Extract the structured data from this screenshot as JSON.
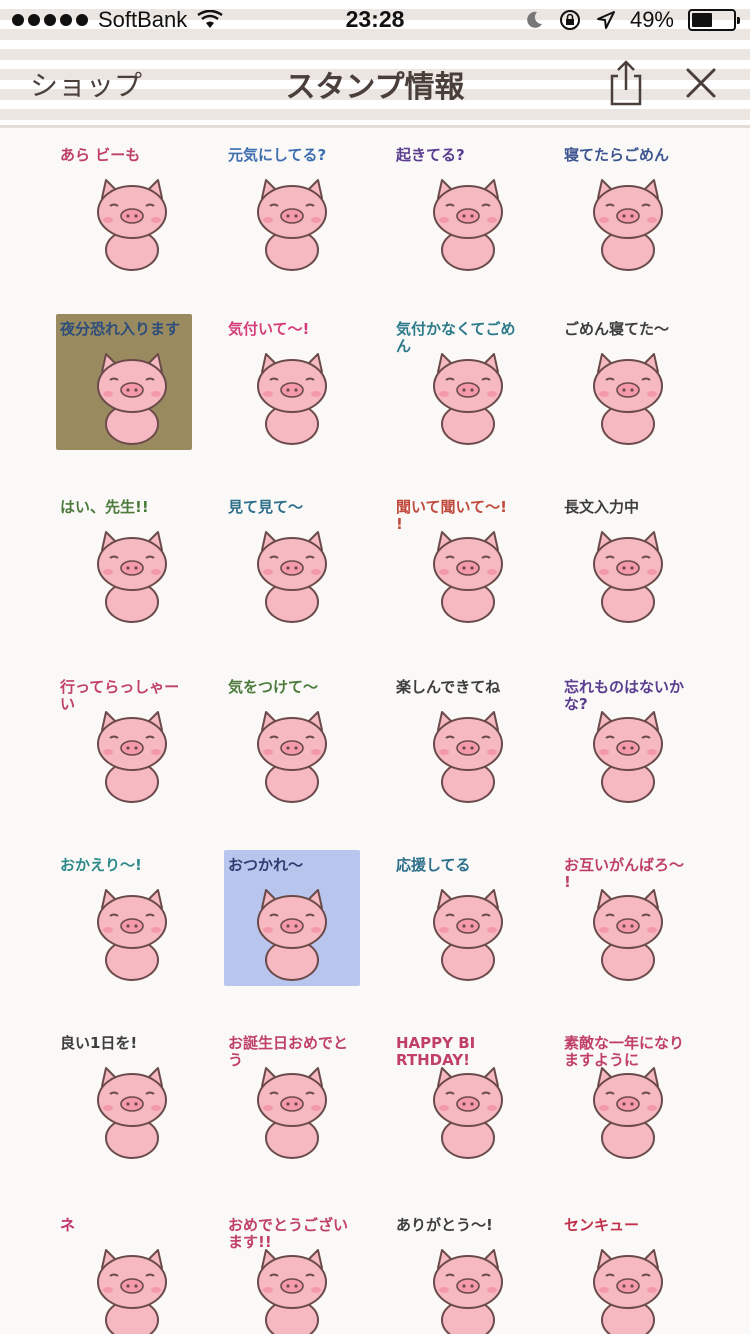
{
  "status_bar": {
    "carrier": "SoftBank",
    "time": "23:28",
    "battery_percent": "49%",
    "battery_level": 0.49,
    "icons": [
      "signal-dots-icon",
      "wifi-icon",
      "moon-icon",
      "rotation-lock-icon",
      "location-arrow-icon",
      "battery-icon"
    ]
  },
  "nav": {
    "back_label": "ショップ",
    "title": "スタンプ情報",
    "share_icon": "share-icon",
    "close_icon": "close-icon"
  },
  "colors": {
    "text": "#4a3f3a",
    "pig": "#f6b9c2",
    "pig_outline": "#6b4a4a",
    "background": "#faf9f7",
    "stripe": "#ebe6e1"
  },
  "stickers": [
    {
      "text": "あら ビーも",
      "color": "#c0406a",
      "bg": "none"
    },
    {
      "text": "元気にしてる?",
      "color": "#3d6fb0",
      "bg": "none"
    },
    {
      "text": "起きてる?",
      "color": "#5b3d8f",
      "bg": "none"
    },
    {
      "text": "寝てたらごめん",
      "color": "#3e5690",
      "bg": "none"
    },
    {
      "text": "夜分恐れ入ります",
      "color": "#2d4d7a",
      "bg": "#9a8a60"
    },
    {
      "text": "気付いて〜!",
      "color": "#d43d7a",
      "bg": "none"
    },
    {
      "text": "気付かなくてごめん",
      "color": "#2d7a8a",
      "bg": "none"
    },
    {
      "text": "ごめん寝てた〜",
      "color": "#3d3d3d",
      "bg": "none"
    },
    {
      "text": "はい、先生!!",
      "color": "#4d7a3d",
      "bg": "none"
    },
    {
      "text": "見て見て〜",
      "color": "#2d6f8a",
      "bg": "none"
    },
    {
      "text": "聞いて聞いて〜!!",
      "color": "#c04a3d",
      "bg": "none"
    },
    {
      "text": "長文入力中",
      "color": "#3d3d3d",
      "bg": "none"
    },
    {
      "text": "行ってらっしゃーい",
      "color": "#c0406a",
      "bg": "none"
    },
    {
      "text": "気をつけて〜",
      "color": "#4d7a3d",
      "bg": "none"
    },
    {
      "text": "楽しんできてね",
      "color": "#3d3d3d",
      "bg": "none"
    },
    {
      "text": "忘れものはないかな?",
      "color": "#5b3d8f",
      "bg": "none"
    },
    {
      "text": "おかえり〜!",
      "color": "#2d8a8a",
      "bg": "none"
    },
    {
      "text": "おつかれ〜",
      "color": "#2d3d6f",
      "bg": "#b8c6ee"
    },
    {
      "text": "応援してる",
      "color": "#2d6f8a",
      "bg": "none"
    },
    {
      "text": "お互いがんばろ〜!",
      "color": "#c0406a",
      "bg": "none"
    },
    {
      "text": "良い1日を!",
      "color": "#3d3d3d",
      "bg": "none"
    },
    {
      "text": "お誕生日おめでとう",
      "color": "#c0406a",
      "bg": "none"
    },
    {
      "text": "HAPPY BIRTHDAY!",
      "color": "#c0406a",
      "bg": "none"
    },
    {
      "text": "素敵な一年になりますように",
      "color": "#c0406a",
      "bg": "none"
    },
    {
      "text": "ネ",
      "color": "#c0306a",
      "bg": "none"
    },
    {
      "text": "おめでとうございます!!",
      "color": "#c0406a",
      "bg": "none"
    },
    {
      "text": "ありがとう〜!",
      "color": "#3d3d3d",
      "bg": "none"
    },
    {
      "text": "センキュー",
      "color": "#c0304a",
      "bg": "none"
    }
  ]
}
